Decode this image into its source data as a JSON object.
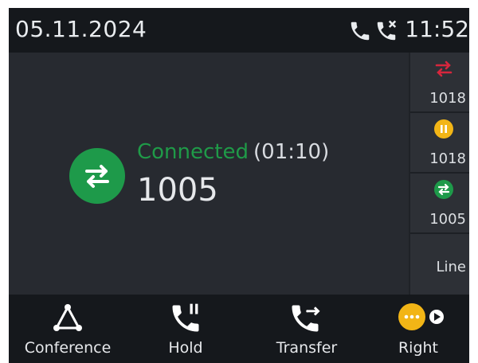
{
  "status_bar": {
    "date": "05.11.2024",
    "time": "11:52",
    "icons": [
      "phone-icon",
      "missed-call-icon"
    ]
  },
  "call": {
    "state": "Connected",
    "duration": "(01:10)",
    "number": "1005",
    "state_color": "#1f9a48",
    "icon": "transfer-arrows-icon"
  },
  "lines": [
    {
      "label": "1018",
      "icon": "forwarded-arrows-icon",
      "color": "#d7263d"
    },
    {
      "label": "1018",
      "icon": "hold-pause-icon",
      "color": "#f2b516"
    },
    {
      "label": "1005",
      "icon": "active-call-icon",
      "color": "#1e9a4a"
    },
    {
      "label": "Line"
    }
  ],
  "softkeys": [
    {
      "label": "Conference",
      "icon": "conference-icon"
    },
    {
      "label": "Hold",
      "icon": "hold-icon"
    },
    {
      "label": "Transfer",
      "icon": "transfer-icon"
    },
    {
      "label": "Right",
      "icon": "more-menu-icon"
    }
  ],
  "colors": {
    "accent_green": "#1e9a4a",
    "accent_yellow": "#f2b516",
    "accent_red": "#d7263d"
  }
}
